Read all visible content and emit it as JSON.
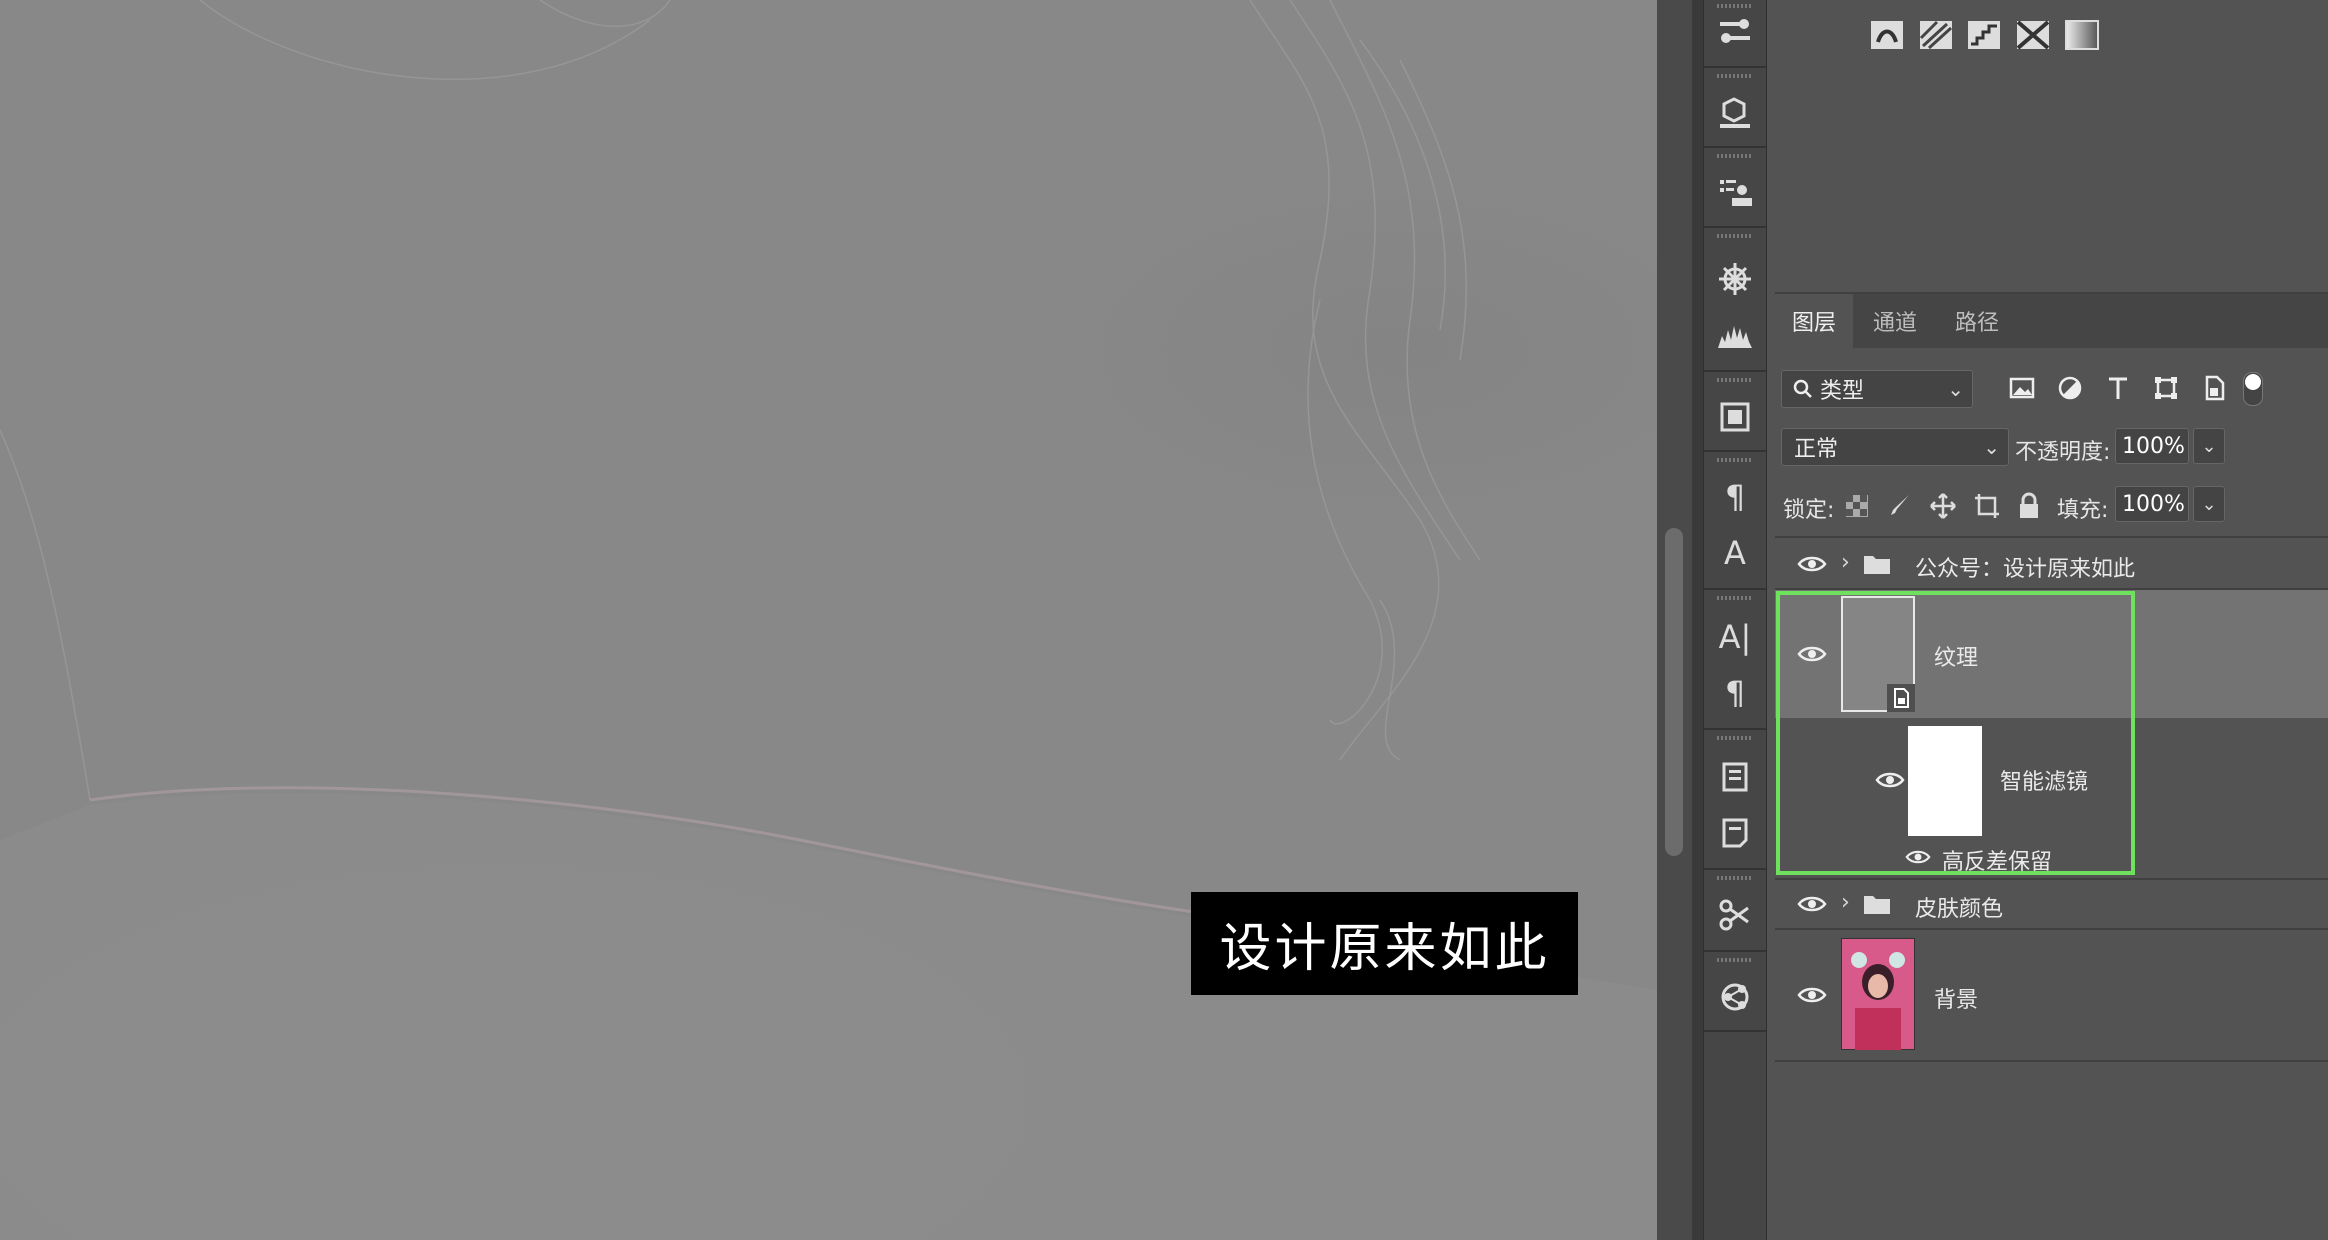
{
  "canvas": {
    "watermark": "设计原来如此"
  },
  "panel": {
    "tabs": [
      {
        "label": "图层",
        "active": true
      },
      {
        "label": "通道",
        "active": false
      },
      {
        "label": "路径",
        "active": false
      }
    ],
    "filter": {
      "kind_label": "类型",
      "icons": [
        "image-filter-icon",
        "adjustment-filter-icon",
        "type-filter-icon",
        "shape-filter-icon",
        "smart-object-filter-icon"
      ]
    },
    "blend": {
      "mode": "正常",
      "opacity_label": "不透明度:",
      "opacity_value": "100%"
    },
    "lock": {
      "label": "锁定:",
      "fill_label": "填充:",
      "fill_value": "100%"
    },
    "layers": [
      {
        "name": "公众号：设计原来如此",
        "type": "group",
        "visible": true
      },
      {
        "name": "纹理",
        "type": "smart-object",
        "visible": true,
        "selected": true
      },
      {
        "name": "智能滤镜",
        "type": "smart-filter-mask",
        "visible": true
      },
      {
        "name": "高反差保留",
        "type": "filter",
        "visible": true
      },
      {
        "name": "皮肤颜色",
        "type": "group",
        "visible": true
      },
      {
        "name": "背景",
        "type": "background",
        "visible": true
      }
    ]
  },
  "colors": {
    "panel_bg": "#535353",
    "canvas_gray": "#888888",
    "highlight": "#6ee25c",
    "selected_row": "#737373"
  }
}
